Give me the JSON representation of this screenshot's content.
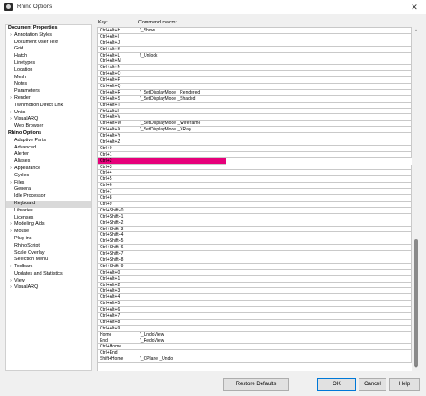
{
  "window": {
    "title": "Rhino Options",
    "close_glyph": "✕"
  },
  "tree": {
    "items": [
      {
        "label": "Document Properties",
        "level": 0,
        "expander": ""
      },
      {
        "label": "Annotation Styles",
        "level": 1,
        "expander": "›"
      },
      {
        "label": "Document User Text",
        "level": 1,
        "expander": ""
      },
      {
        "label": "Grid",
        "level": 1,
        "expander": ""
      },
      {
        "label": "Hatch",
        "level": 1,
        "expander": ""
      },
      {
        "label": "Linetypes",
        "level": 1,
        "expander": ""
      },
      {
        "label": "Location",
        "level": 1,
        "expander": ""
      },
      {
        "label": "Mesh",
        "level": 1,
        "expander": ""
      },
      {
        "label": "Notes",
        "level": 1,
        "expander": ""
      },
      {
        "label": "Parameters",
        "level": 1,
        "expander": ""
      },
      {
        "label": "Render",
        "level": 1,
        "expander": "›"
      },
      {
        "label": "Twinmotion Direct Link",
        "level": 1,
        "expander": ""
      },
      {
        "label": "Units",
        "level": 1,
        "expander": "›"
      },
      {
        "label": "VisualARQ",
        "level": 1,
        "expander": "›"
      },
      {
        "label": "Web Browser",
        "level": 1,
        "expander": ""
      },
      {
        "label": "Rhino Options",
        "level": 0,
        "expander": ""
      },
      {
        "label": "Adaptive Parts",
        "level": 1,
        "expander": ""
      },
      {
        "label": "Advanced",
        "level": 1,
        "expander": ""
      },
      {
        "label": "Alerter",
        "level": 1,
        "expander": ""
      },
      {
        "label": "Aliases",
        "level": 1,
        "expander": ""
      },
      {
        "label": "Appearance",
        "level": 1,
        "expander": "›"
      },
      {
        "label": "Cycles",
        "level": 1,
        "expander": ""
      },
      {
        "label": "Files",
        "level": 1,
        "expander": "›"
      },
      {
        "label": "General",
        "level": 1,
        "expander": ""
      },
      {
        "label": "Idle Processor",
        "level": 1,
        "expander": ""
      },
      {
        "label": "Keyboard",
        "level": 1,
        "expander": "",
        "selected": true
      },
      {
        "label": "Libraries",
        "level": 1,
        "expander": ""
      },
      {
        "label": "Licenses",
        "level": 1,
        "expander": ""
      },
      {
        "label": "Modeling Aids",
        "level": 1,
        "expander": "›"
      },
      {
        "label": "Mouse",
        "level": 1,
        "expander": "›"
      },
      {
        "label": "Plug-ins",
        "level": 1,
        "expander": ""
      },
      {
        "label": "RhinoScript",
        "level": 1,
        "expander": ""
      },
      {
        "label": "Scale Overlay",
        "level": 1,
        "expander": ""
      },
      {
        "label": "Selection Menu",
        "level": 1,
        "expander": ""
      },
      {
        "label": "Toolbars",
        "level": 1,
        "expander": "›"
      },
      {
        "label": "Updates and Statistics",
        "level": 1,
        "expander": ""
      },
      {
        "label": "View",
        "level": 1,
        "expander": "›"
      },
      {
        "label": "VisualARQ",
        "level": 1,
        "expander": "›"
      }
    ]
  },
  "grid": {
    "headers": {
      "key": "Key:",
      "macro": "Command macro:"
    },
    "rows": [
      {
        "key": "Ctrl+Alt+H",
        "macro": "'_Show"
      },
      {
        "key": "Ctrl+Alt+I",
        "macro": ""
      },
      {
        "key": "Ctrl+Alt+J",
        "macro": ""
      },
      {
        "key": "Ctrl+Alt+K",
        "macro": ""
      },
      {
        "key": "Ctrl+Alt+L",
        "macro": "!_Unlock"
      },
      {
        "key": "Ctrl+Alt+M",
        "macro": ""
      },
      {
        "key": "Ctrl+Alt+N",
        "macro": ""
      },
      {
        "key": "Ctrl+Alt+O",
        "macro": ""
      },
      {
        "key": "Ctrl+Alt+P",
        "macro": ""
      },
      {
        "key": "Ctrl+Alt+Q",
        "macro": ""
      },
      {
        "key": "Ctrl+Alt+R",
        "macro": "'_SetDisplayMode _Rendered"
      },
      {
        "key": "Ctrl+Alt+S",
        "macro": "'_SetDisplayMode _Shaded"
      },
      {
        "key": "Ctrl+Alt+T",
        "macro": ""
      },
      {
        "key": "Ctrl+Alt+U",
        "macro": ""
      },
      {
        "key": "Ctrl+Alt+V",
        "macro": ""
      },
      {
        "key": "Ctrl+Alt+W",
        "macro": "'_SetDisplayMode _Wireframe"
      },
      {
        "key": "Ctrl+Alt+X",
        "macro": "'_SetDisplayMode _XRay"
      },
      {
        "key": "Ctrl+Alt+Y",
        "macro": ""
      },
      {
        "key": "Ctrl+Alt+Z",
        "macro": ""
      },
      {
        "key": "Ctrl+0",
        "macro": ""
      },
      {
        "key": "Ctrl+1",
        "macro": ""
      },
      {
        "key": "Ctrl+2",
        "macro": "",
        "selected": true
      },
      {
        "key": "Ctrl+3",
        "macro": ""
      },
      {
        "key": "Ctrl+4",
        "macro": ""
      },
      {
        "key": "Ctrl+5",
        "macro": ""
      },
      {
        "key": "Ctrl+6",
        "macro": ""
      },
      {
        "key": "Ctrl+7",
        "macro": ""
      },
      {
        "key": "Ctrl+8",
        "macro": ""
      },
      {
        "key": "Ctrl+9",
        "macro": ""
      },
      {
        "key": "Ctrl+Shift+0",
        "macro": ""
      },
      {
        "key": "Ctrl+Shift+1",
        "macro": ""
      },
      {
        "key": "Ctrl+Shift+2",
        "macro": ""
      },
      {
        "key": "Ctrl+Shift+3",
        "macro": ""
      },
      {
        "key": "Ctrl+Shift+4",
        "macro": ""
      },
      {
        "key": "Ctrl+Shift+5",
        "macro": ""
      },
      {
        "key": "Ctrl+Shift+6",
        "macro": ""
      },
      {
        "key": "Ctrl+Shift+7",
        "macro": ""
      },
      {
        "key": "Ctrl+Shift+8",
        "macro": ""
      },
      {
        "key": "Ctrl+Shift+9",
        "macro": ""
      },
      {
        "key": "Ctrl+Alt+0",
        "macro": ""
      },
      {
        "key": "Ctrl+Alt+1",
        "macro": ""
      },
      {
        "key": "Ctrl+Alt+2",
        "macro": ""
      },
      {
        "key": "Ctrl+Alt+3",
        "macro": ""
      },
      {
        "key": "Ctrl+Alt+4",
        "macro": ""
      },
      {
        "key": "Ctrl+Alt+5",
        "macro": ""
      },
      {
        "key": "Ctrl+Alt+6",
        "macro": ""
      },
      {
        "key": "Ctrl+Alt+7",
        "macro": ""
      },
      {
        "key": "Ctrl+Alt+8",
        "macro": ""
      },
      {
        "key": "Ctrl+Alt+9",
        "macro": ""
      },
      {
        "key": "Home",
        "macro": "'_UndoView"
      },
      {
        "key": "End",
        "macro": "'_RedoView"
      },
      {
        "key": "Ctrl+Home",
        "macro": ""
      },
      {
        "key": "Ctrl+End",
        "macro": ""
      },
      {
        "key": "Shift+Home",
        "macro": "'_CPlane _Undo"
      }
    ]
  },
  "buttons": {
    "restore_defaults": "Restore Defaults",
    "ok": "OK",
    "cancel": "Cancel",
    "help": "Help"
  },
  "colors": {
    "selection_accent": "#e6007a",
    "primary_border": "#0078d7"
  }
}
